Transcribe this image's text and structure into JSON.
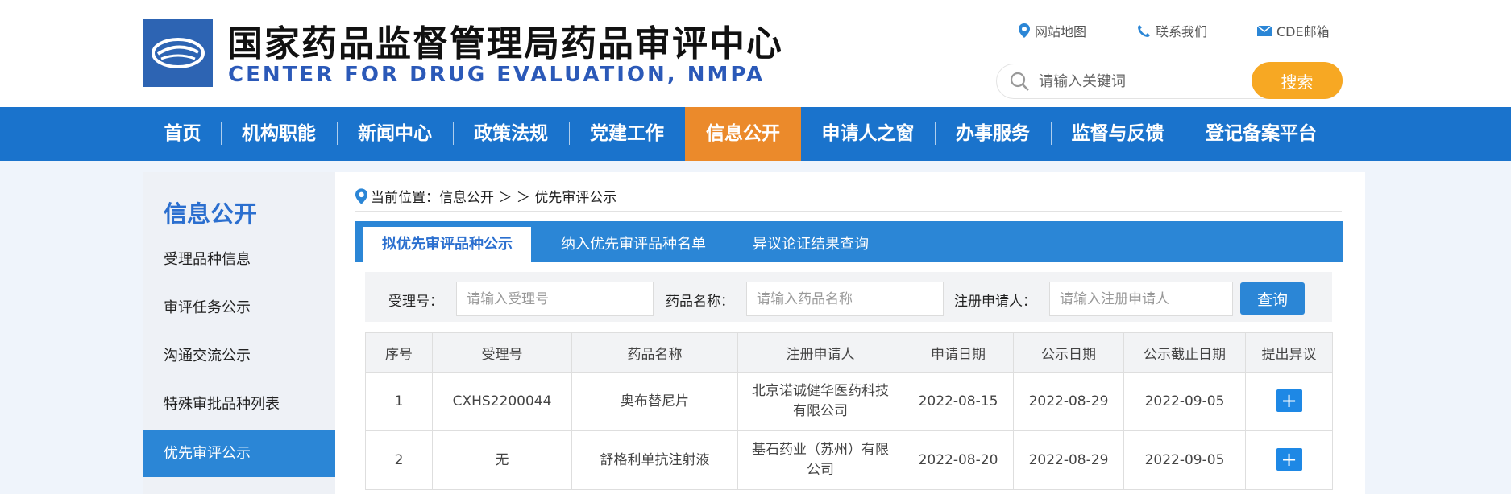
{
  "header": {
    "title": "国家药品监督管理局药品审评中心",
    "subtitle": "CENTER FOR DRUG EVALUATION, NMPA",
    "links": {
      "sitemap": "网站地图",
      "contact": "联系我们",
      "mail": "CDE邮箱"
    },
    "search": {
      "placeholder": "请输入关键词",
      "button": "搜索"
    }
  },
  "nav": {
    "items": [
      "首页",
      "机构职能",
      "新闻中心",
      "政策法规",
      "党建工作",
      "信息公开",
      "申请人之窗",
      "办事服务",
      "监督与反馈",
      "登记备案平台"
    ],
    "active_index": 5
  },
  "sidebar": {
    "title": "信息公开",
    "items": [
      "受理品种信息",
      "审评任务公示",
      "沟通交流公示",
      "特殊审批品种列表",
      "优先审评公示"
    ],
    "active_index": 4
  },
  "breadcrumb": {
    "prefix": "当前位置：",
    "path": "信息公开 ＞ ＞ 优先审评公示"
  },
  "tabs": {
    "items": [
      "拟优先审评品种公示",
      "纳入优先审评品种名单",
      "异议论证结果查询"
    ],
    "active_index": 0
  },
  "filters": {
    "accept_no": {
      "label": "受理号：",
      "placeholder": "请输入受理号"
    },
    "drug_name": {
      "label": "药品名称：",
      "placeholder": "请输入药品名称"
    },
    "applicant": {
      "label": "注册申请人：",
      "placeholder": "请输入注册申请人"
    },
    "query_button": "查询"
  },
  "table": {
    "columns": [
      "序号",
      "受理号",
      "药品名称",
      "注册申请人",
      "申请日期",
      "公示日期",
      "公示截止日期",
      "提出异议"
    ],
    "rows": [
      {
        "no": "1",
        "accept_no": "CXHS2200044",
        "drug": "奥布替尼片",
        "applicant": "北京诺诚健华医药科技有限公司",
        "apply_date": "2022-08-15",
        "publish_date": "2022-08-29",
        "deadline": "2022-09-05",
        "objection": "+"
      },
      {
        "no": "2",
        "accept_no": "无",
        "drug": "舒格利单抗注射液",
        "applicant": "基石药业（苏州）有限公司",
        "apply_date": "2022-08-20",
        "publish_date": "2022-08-29",
        "deadline": "2022-09-05",
        "objection": "+"
      }
    ]
  },
  "colors": {
    "nav_blue": "#1a73cc",
    "accent_orange": "#eb8a2b",
    "search_orange": "#f7a823",
    "tab_blue": "#2b86d6"
  }
}
